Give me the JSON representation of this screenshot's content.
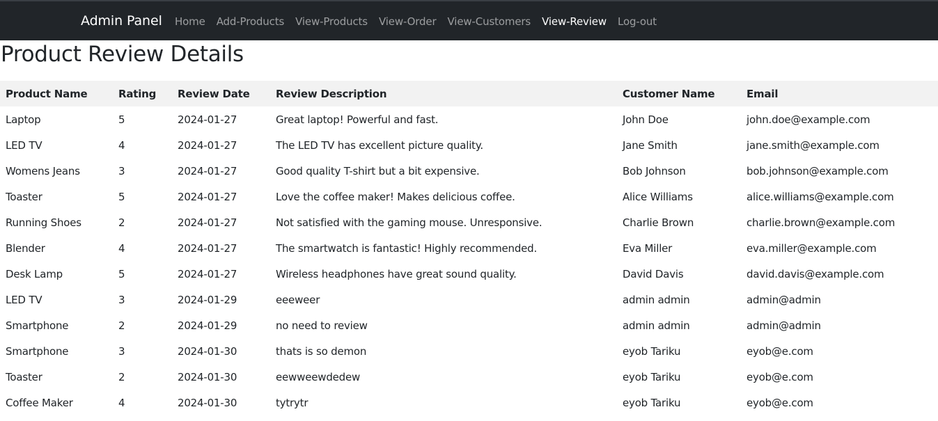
{
  "navbar": {
    "brand": "Admin Panel",
    "links": [
      {
        "label": "Home"
      },
      {
        "label": "Add-Products"
      },
      {
        "label": "View-Products"
      },
      {
        "label": "View-Order"
      },
      {
        "label": "View-Customers"
      },
      {
        "label": "View-Review",
        "active": true
      },
      {
        "label": "Log-out"
      }
    ]
  },
  "page": {
    "title": "Product Review Details"
  },
  "table": {
    "headers": [
      "Product Name",
      "Rating",
      "Review Date",
      "Review Description",
      "Customer Name",
      "Email"
    ],
    "rows": [
      [
        "Laptop",
        "5",
        "2024-01-27",
        "Great laptop! Powerful and fast.",
        "John Doe",
        "john.doe@example.com"
      ],
      [
        "LED TV",
        "4",
        "2024-01-27",
        "The LED TV has excellent picture quality.",
        "Jane Smith",
        "jane.smith@example.com"
      ],
      [
        "Womens Jeans",
        "3",
        "2024-01-27",
        "Good quality T-shirt but a bit expensive.",
        "Bob Johnson",
        "bob.johnson@example.com"
      ],
      [
        "Toaster",
        "5",
        "2024-01-27",
        "Love the coffee maker! Makes delicious coffee.",
        "Alice Williams",
        "alice.williams@example.com"
      ],
      [
        "Running Shoes",
        "2",
        "2024-01-27",
        "Not satisfied with the gaming mouse. Unresponsive.",
        "Charlie Brown",
        "charlie.brown@example.com"
      ],
      [
        "Blender",
        "4",
        "2024-01-27",
        "The smartwatch is fantastic! Highly recommended.",
        "Eva Miller",
        "eva.miller@example.com"
      ],
      [
        "Desk Lamp",
        "5",
        "2024-01-27",
        "Wireless headphones have great sound quality.",
        "David Davis",
        "david.davis@example.com"
      ],
      [
        "LED TV",
        "3",
        "2024-01-29",
        "eeeweer",
        "admin admin",
        "admin@admin"
      ],
      [
        "Smartphone",
        "2",
        "2024-01-29",
        "no need to review",
        "admin admin",
        "admin@admin"
      ],
      [
        "Smartphone",
        "3",
        "2024-01-30",
        "thats is so demon",
        "eyob Tariku",
        "eyob@e.com"
      ],
      [
        "Toaster",
        "2",
        "2024-01-30",
        "eewweewdedew",
        "eyob Tariku",
        "eyob@e.com"
      ],
      [
        "Coffee Maker",
        "4",
        "2024-01-30",
        "tytrytr",
        "eyob Tariku",
        "eyob@e.com"
      ]
    ]
  },
  "colors": {
    "navbar_bg": "#212529",
    "header_row_bg": "#f2f2f2",
    "text": "#212529"
  }
}
